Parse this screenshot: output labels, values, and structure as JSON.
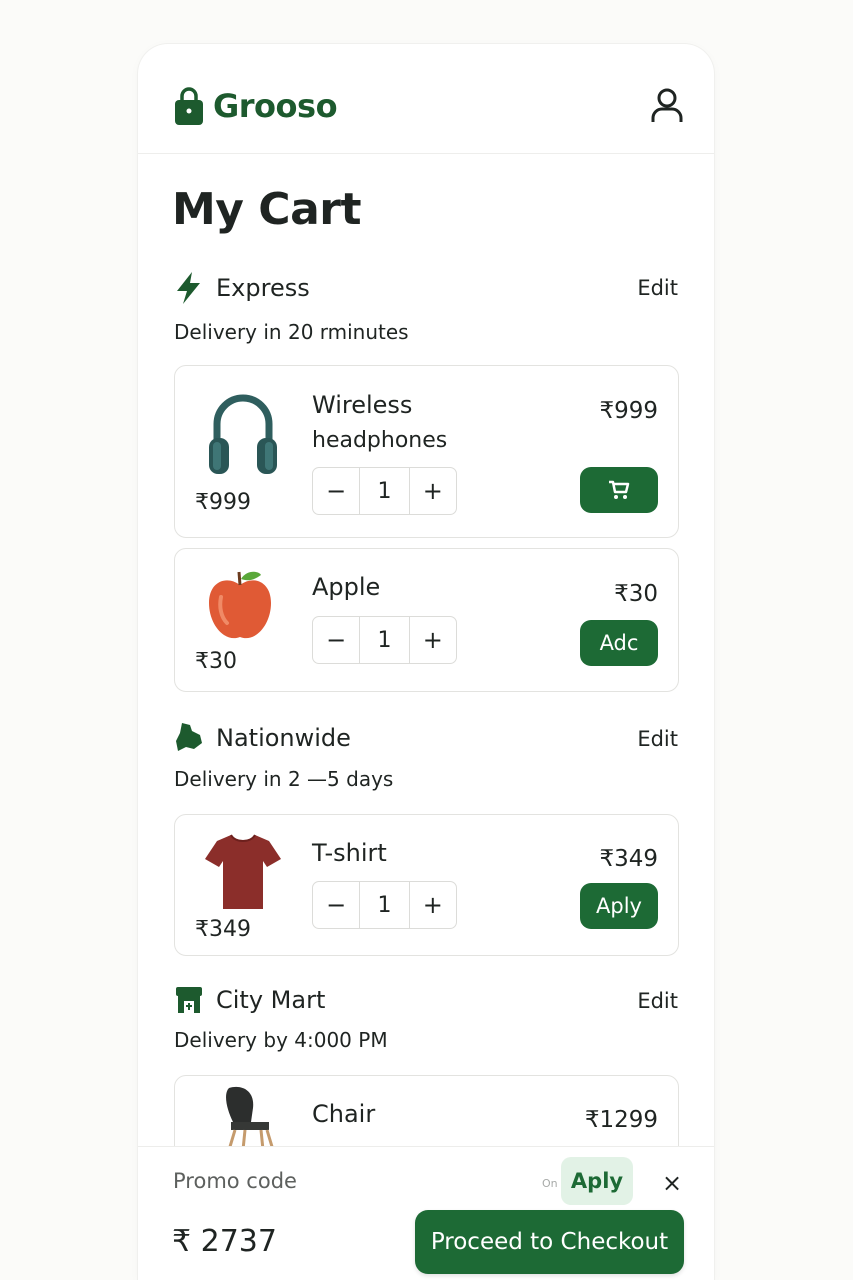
{
  "app": {
    "name": "Grooso"
  },
  "page": {
    "title": "My Cart"
  },
  "sections": [
    {
      "name": "Express",
      "edit_label": "Edit",
      "delivery": "Delivery in 20 rminutes",
      "items": [
        {
          "name_line1": "Wireless",
          "name_line2": "headphones",
          "thumb_price": "₹999",
          "price": "₹999",
          "qty": "1",
          "action": "cart-icon"
        },
        {
          "name_line1": "Apple",
          "thumb_price": "₹30",
          "price": "₹30",
          "qty": "1",
          "action_label": "Adc"
        }
      ]
    },
    {
      "name": "Nationwide",
      "edit_label": "Edit",
      "delivery": "Delivery in 2 —5 days",
      "items": [
        {
          "name_line1": "T-shirt",
          "thumb_price": "₹349",
          "price": "₹349",
          "qty": "1",
          "action_label": "Aply"
        }
      ]
    },
    {
      "name": "City Mart",
      "edit_label": "Edit",
      "delivery": "Delivery by 4:000 PM",
      "items": [
        {
          "name_line1": "Chair",
          "price": "₹1299"
        }
      ]
    }
  ],
  "stepper": {
    "minus": "−",
    "plus": "+"
  },
  "promo": {
    "label": "Promo code",
    "on_text": "On",
    "apply_label": "Aply",
    "close": "×"
  },
  "footer": {
    "total": "₹ 2737",
    "checkout_label": "Proceed to Checkout"
  },
  "colors": {
    "brand": "#1d5a2e",
    "button": "#1d6a35",
    "promo_bg": "#e2f2e6"
  }
}
